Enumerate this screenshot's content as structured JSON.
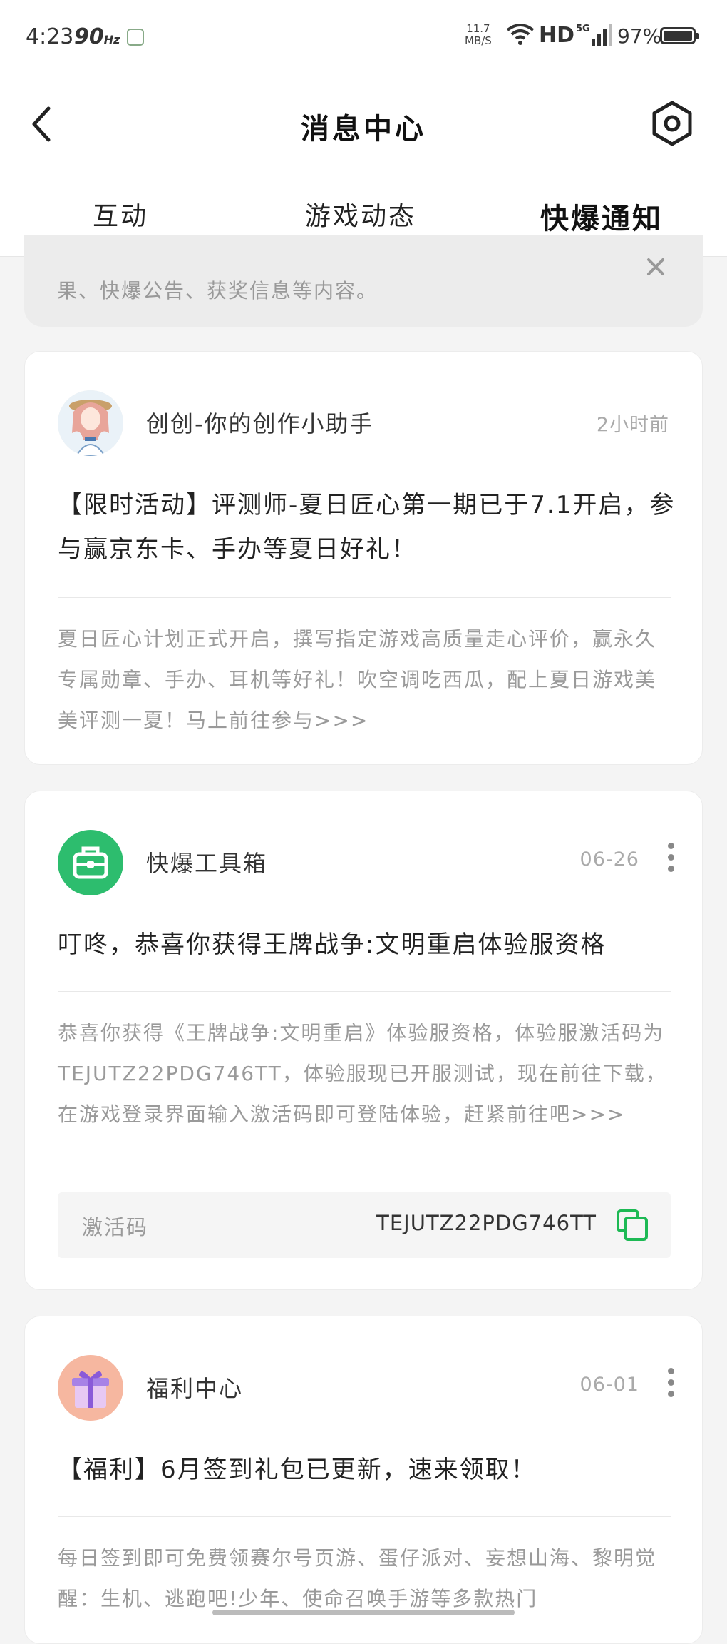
{
  "status_bar": {
    "time": "4:23",
    "refresh_rate": "90",
    "refresh_unit": "Hz",
    "net_speed_value": "11.7",
    "net_speed_unit": "MB/S",
    "hd_label": "HD",
    "signal_label": "5G",
    "battery": "97%"
  },
  "header": {
    "title": "消息中心",
    "back_icon": "chevron-left-icon",
    "settings_icon": "hexagon-settings-icon"
  },
  "tabs": [
    {
      "label": "互动",
      "active": false
    },
    {
      "label": "游戏动态",
      "active": false
    },
    {
      "label": "快爆通知",
      "active": true
    }
  ],
  "accent_color": "#1db954",
  "notice": {
    "text": "果、快爆公告、获奖信息等内容。",
    "close_icon": "close-icon"
  },
  "messages": [
    {
      "sender": "创创-你的创作小助手",
      "time": "2小时前",
      "title": "【限时活动】评测师-夏日匠心第一期已于7.1开启，参与赢京东卡、手办等夏日好礼！",
      "body": "夏日匠心计划正式开启，撰写指定游戏高质量走心评价，赢永久专属勋章、手办、耳机等好礼！吹空调吃西瓜，配上夏日游戏美美评测一夏！马上前往参与>>>"
    },
    {
      "sender": "快爆工具箱",
      "time": "06-26",
      "title": "叮咚，恭喜你获得王牌战争:文明重启体验服资格",
      "body": "恭喜你获得《王牌战争:文明重启》体验服资格，体验服激活码为TEJUTZ22PDG746TT，体验服现已开服测试，现在前往下载，在游戏登录界面输入激活码即可登陆体验，赶紧前往吧>>>",
      "code_label": "激活码",
      "code_value": "TEJUTZ22PDG746TT"
    },
    {
      "sender": "福利中心",
      "time": "06-01",
      "title": "【福利】6月签到礼包已更新，速来领取！",
      "body": "每日签到即可免费领赛尔号页游、蛋仔派对、妄想山海、黎明觉醒：生机、逃跑吧!少年、使命召唤手游等多款热门"
    }
  ]
}
